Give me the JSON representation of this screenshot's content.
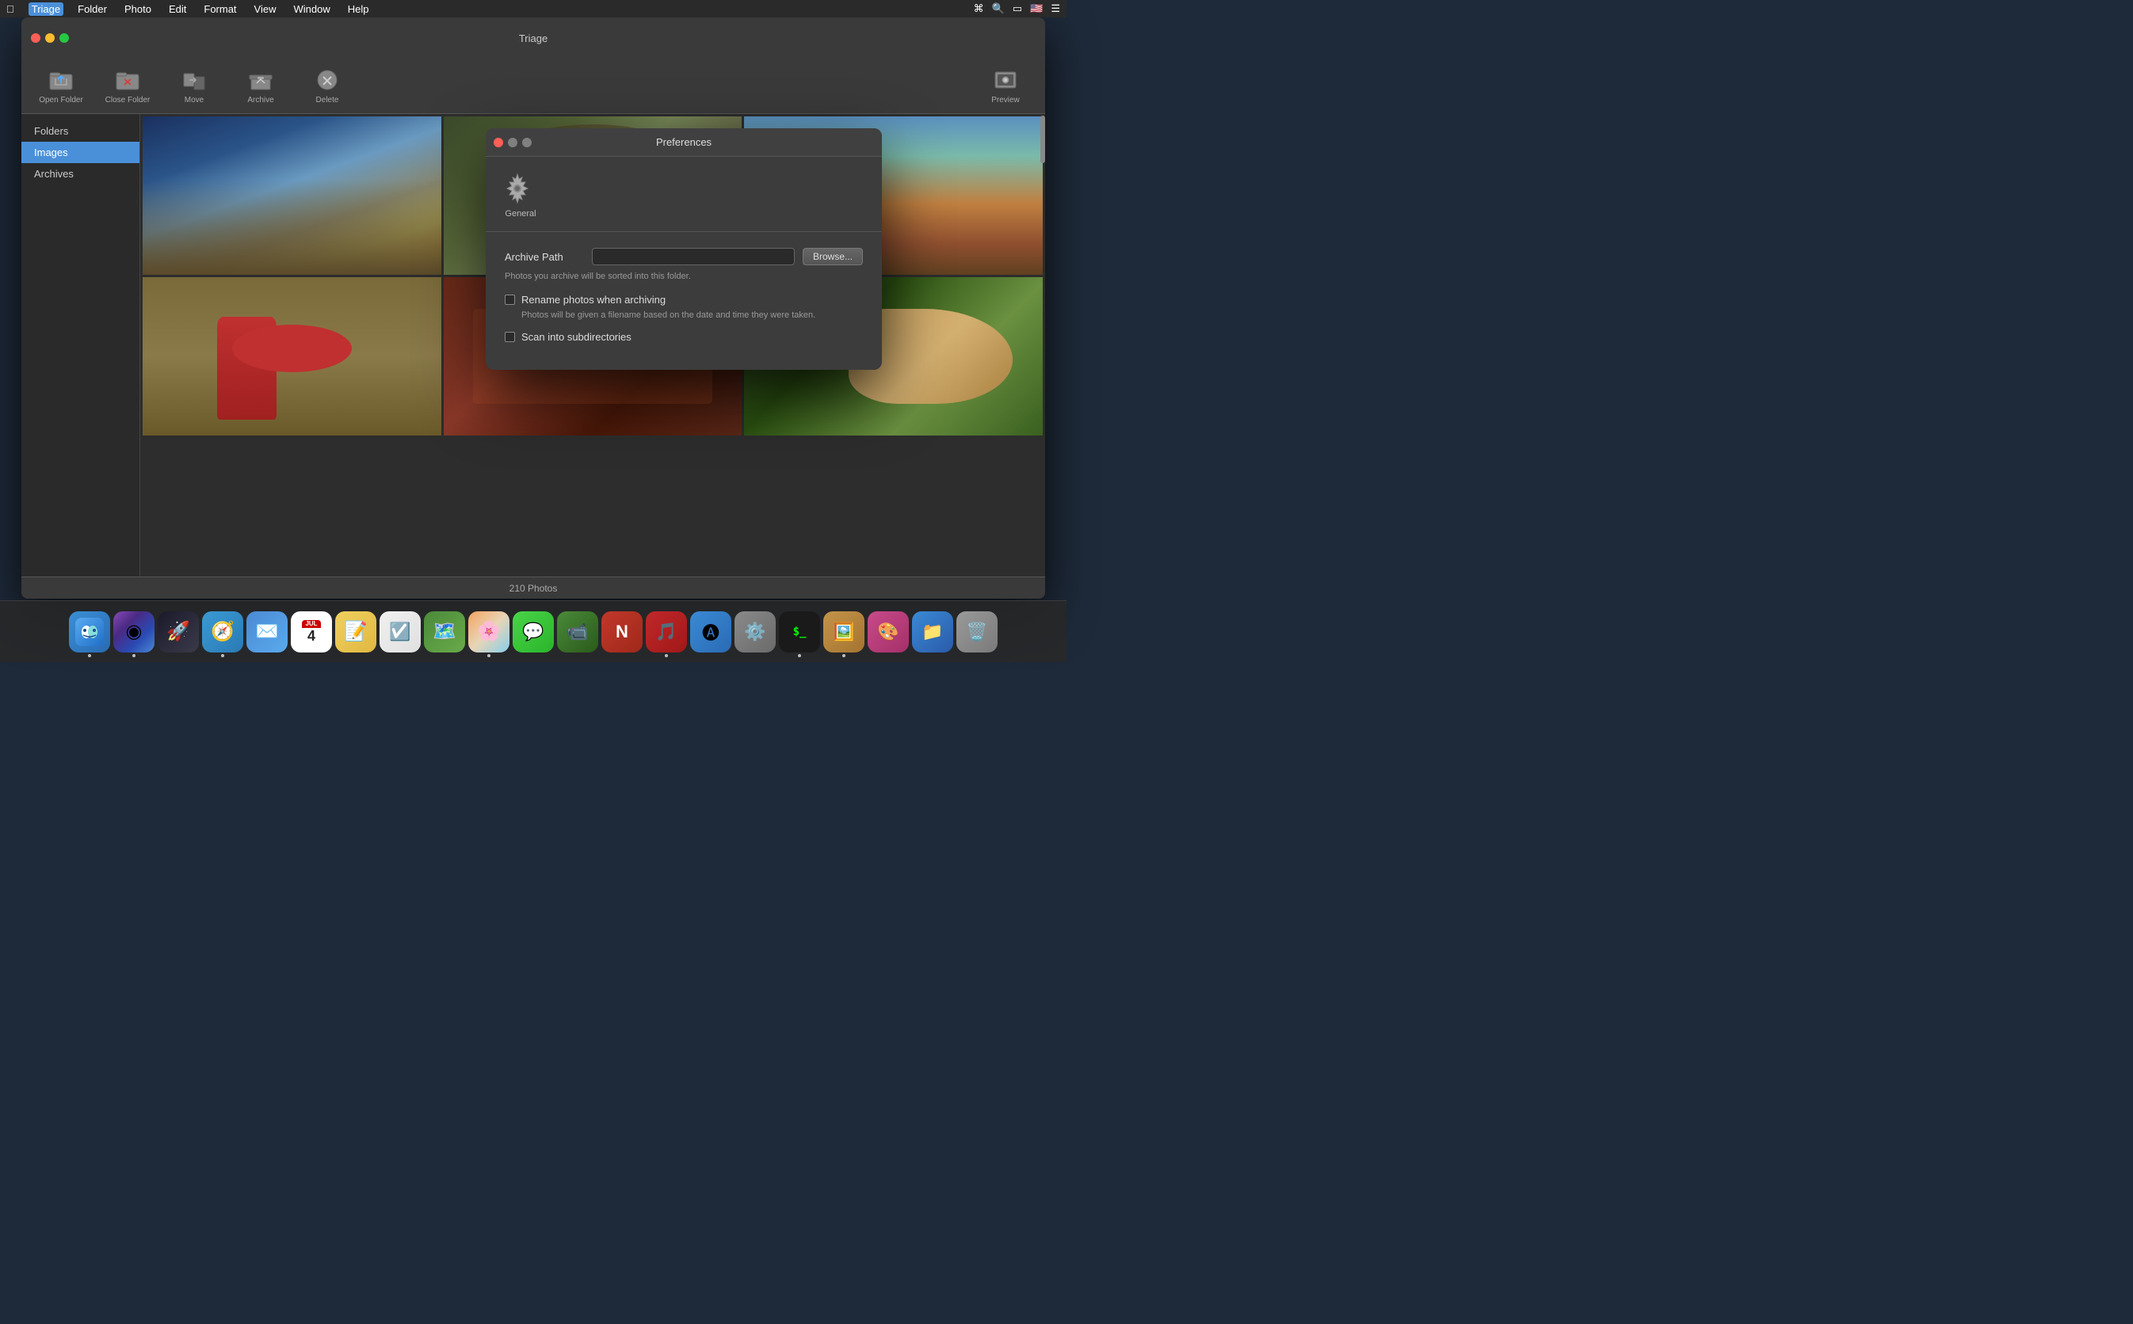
{
  "menubar": {
    "apple": "🍎",
    "items": [
      {
        "id": "triage",
        "label": "Triage",
        "active": true
      },
      {
        "id": "folder",
        "label": "Folder"
      },
      {
        "id": "photo",
        "label": "Photo"
      },
      {
        "id": "edit",
        "label": "Edit"
      },
      {
        "id": "format",
        "label": "Format"
      },
      {
        "id": "view",
        "label": "View"
      },
      {
        "id": "window",
        "label": "Window"
      },
      {
        "id": "help",
        "label": "Help"
      }
    ]
  },
  "window": {
    "title": "Triage"
  },
  "toolbar": {
    "open_folder": "Open Folder",
    "close_folder": "Close Folder",
    "move": "Move",
    "archive": "Archive",
    "delete": "Delete",
    "preview": "Preview"
  },
  "sidebar": {
    "items": [
      {
        "id": "folders",
        "label": "Folders",
        "active": false
      },
      {
        "id": "images",
        "label": "Images",
        "active": true
      },
      {
        "id": "archives",
        "label": "Archives",
        "active": false
      }
    ]
  },
  "status_bar": {
    "count": "210 Photos"
  },
  "preferences": {
    "title": "Preferences",
    "general_label": "General",
    "archive_path_label": "Archive Path",
    "archive_path_value": "",
    "browse_button": "Browse...",
    "archive_path_desc": "Photos you archive will be sorted into this folder.",
    "rename_label": "Rename photos when archiving",
    "rename_desc": "Photos will be given a filename based on the date and time they were taken.",
    "scan_label": "Scan into subdirectories"
  },
  "dock": {
    "items": [
      {
        "id": "finder",
        "label": "Finder",
        "emoji": "🔍"
      },
      {
        "id": "siri",
        "label": "Siri",
        "emoji": "◉"
      },
      {
        "id": "rocket",
        "label": "Launchpad",
        "emoji": "🚀"
      },
      {
        "id": "safari",
        "label": "Safari",
        "emoji": "🧭"
      },
      {
        "id": "mail",
        "label": "Mail",
        "emoji": "✉"
      },
      {
        "id": "calendar",
        "label": "Calendar",
        "emoji": "📅"
      },
      {
        "id": "notes",
        "label": "Notes",
        "emoji": "📝"
      },
      {
        "id": "reminders",
        "label": "Reminders",
        "emoji": "🔔"
      },
      {
        "id": "maps",
        "label": "Maps",
        "emoji": "🗺"
      },
      {
        "id": "photos",
        "label": "Photos",
        "emoji": "🌸"
      },
      {
        "id": "messages",
        "label": "Messages",
        "emoji": "💬"
      },
      {
        "id": "facetime",
        "label": "Facetime",
        "emoji": "📹"
      },
      {
        "id": "news",
        "label": "News",
        "emoji": "📰"
      },
      {
        "id": "music",
        "label": "Music",
        "emoji": "🎵"
      },
      {
        "id": "appstore",
        "label": "App Store",
        "emoji": "🅐"
      },
      {
        "id": "syspref",
        "label": "System Preferences",
        "emoji": "⚙"
      },
      {
        "id": "terminal",
        "label": "Terminal",
        "emoji": "$"
      },
      {
        "id": "imageview",
        "label": "Image Viewer",
        "emoji": "🖼"
      },
      {
        "id": "colorpicker",
        "label": "Color Picker",
        "emoji": "🎨"
      },
      {
        "id": "files",
        "label": "Files",
        "emoji": "📁"
      },
      {
        "id": "trash",
        "label": "Trash",
        "emoji": "🗑"
      }
    ]
  }
}
